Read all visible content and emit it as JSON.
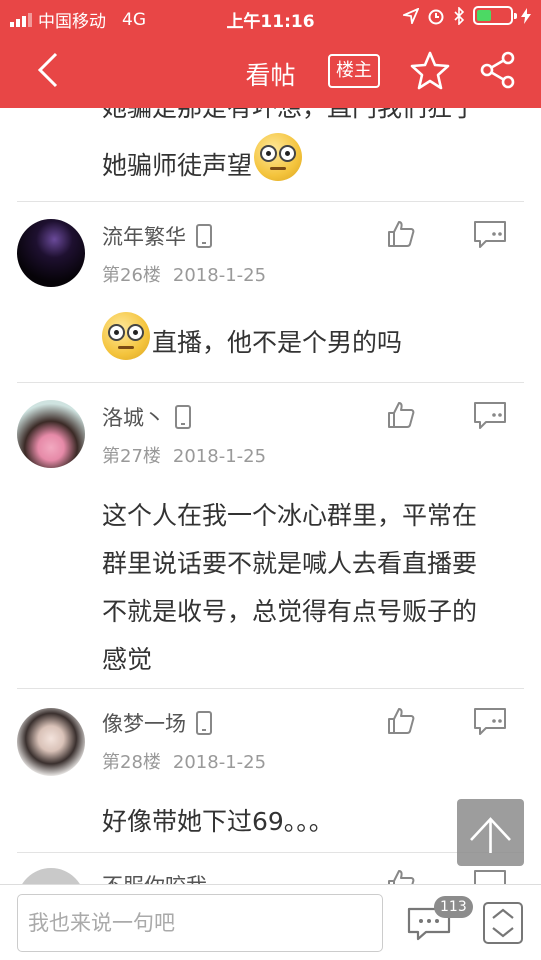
{
  "status_bar": {
    "carrier": "中国移动",
    "network": "4G",
    "time": "上午11:16",
    "battery_percent": 45
  },
  "navbar": {
    "title": "看帖",
    "owner_label": "楼主"
  },
  "previous_post": {
    "cut_line": "她骗是那是有坏想，直门我们狂了",
    "last_line": "她骗师徒声望"
  },
  "posts": [
    {
      "username": "流年繁华",
      "floor": "第26楼",
      "date": "2018-1-25",
      "text": "直播，他不是个男的吗",
      "leading_emoji": "shocked-face"
    },
    {
      "username": "洛城丶",
      "floor": "第27楼",
      "date": "2018-1-25",
      "lines": [
        "这个人在我一个冰心群里，平常在",
        "群里说话要不就是喊人去看直播要",
        "不就是收号，总觉得有点号贩子的",
        "感觉"
      ]
    },
    {
      "username": "像梦一场",
      "floor": "第28楼",
      "date": "2018-1-25",
      "text": "好像带她下过69。。。"
    },
    {
      "username": "不服你咬我"
    }
  ],
  "bottom_bar": {
    "placeholder": "我也来说一句吧",
    "comment_count": "113"
  },
  "colors": {
    "brand_red": "#e84646",
    "text": "#333333",
    "meta": "#999999"
  }
}
